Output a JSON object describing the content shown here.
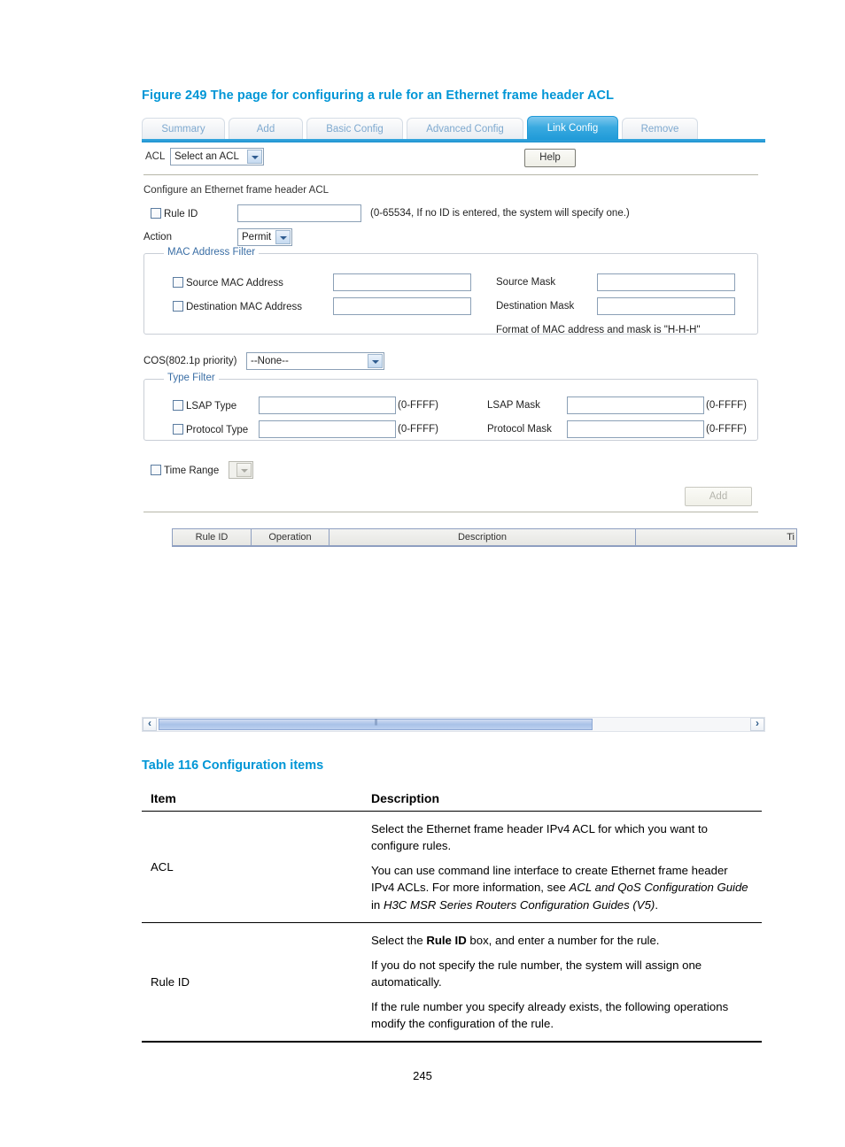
{
  "figure": {
    "caption": "Figure 249 The page for configuring a rule for an Ethernet frame header ACL"
  },
  "screen": {
    "tabs": [
      {
        "label": "Summary",
        "active": false
      },
      {
        "label": "Add",
        "active": false
      },
      {
        "label": "Basic Config",
        "active": false
      },
      {
        "label": "Advanced Config",
        "active": false
      },
      {
        "label": "Link Config",
        "active": true
      },
      {
        "label": "Remove",
        "active": false
      }
    ],
    "acl_row": {
      "label": "ACL",
      "select_value": "Select an ACL",
      "help_label": "Help"
    },
    "section_title": "Configure an Ethernet frame header ACL",
    "rule_id": {
      "checkbox_label": "Rule ID",
      "input_value": "",
      "hint": "(0-65534, If no ID is entered, the system will specify one.)"
    },
    "action": {
      "label": "Action",
      "value": "Permit"
    },
    "mac_filter": {
      "legend": "MAC Address Filter",
      "source_mac_label": "Source MAC Address",
      "destination_mac_label": "Destination MAC Address",
      "source_mask_label": "Source Mask",
      "destination_mask_label": "Destination Mask",
      "source_mac_value": "",
      "destination_mac_value": "",
      "source_mask_value": "",
      "destination_mask_value": "",
      "format_note": "Format of MAC address and mask is \"H-H-H\""
    },
    "cos": {
      "label": "COS(802.1p priority)",
      "value": "--None--"
    },
    "type_filter": {
      "legend": "Type Filter",
      "lsap_type_label": "LSAP Type",
      "protocol_type_label": "Protocol Type",
      "lsap_mask_label": "LSAP Mask",
      "protocol_mask_label": "Protocol Mask",
      "lsap_type_value": "",
      "protocol_type_value": "",
      "lsap_mask_value": "",
      "protocol_mask_value": "",
      "range_hint": "(0-FFFF)"
    },
    "time_range": {
      "checkbox_label": "Time Range",
      "value": ""
    },
    "add_button_label": "Add",
    "results_table": {
      "columns": [
        "Rule ID",
        "Operation",
        "Description",
        "Ti"
      ]
    },
    "scrollbar": {
      "left_arrow": "‹",
      "right_arrow": "›"
    }
  },
  "table116": {
    "caption": "Table 116 Configuration items",
    "headers": {
      "item": "Item",
      "description": "Description"
    },
    "rows": [
      {
        "item": "ACL",
        "paragraphs": [
          "Select the Ethernet frame header IPv4 ACL for which you want to configure rules."
        ]
      },
      {
        "item": "Rule ID",
        "paragraphs": [
          "If you do not specify the rule number, the system will assign one automatically.",
          "If the rule number you specify already exists, the following operations modify the configuration of the rule."
        ]
      }
    ],
    "acl_para2_pre": "You can use command line interface to create Ethernet frame header IPv4 ACLs. For more information, see ",
    "acl_para2_em1": "ACL and QoS Configuration Guide",
    "acl_para2_mid": " in ",
    "acl_para2_em2": "H3C MSR Series Routers Configuration Guides (V5)",
    "acl_para2_post": ".",
    "ruleid_para1_pre": "Select the ",
    "ruleid_para1_bold": "Rule ID",
    "ruleid_para1_post": " box, and enter a number for the rule."
  },
  "footer": {
    "page_number": "245"
  },
  "colors": {
    "accent": "#0096d6",
    "tab_active_bg": "#1f9ad8",
    "tab_inactive_text": "#7ea9cf"
  }
}
